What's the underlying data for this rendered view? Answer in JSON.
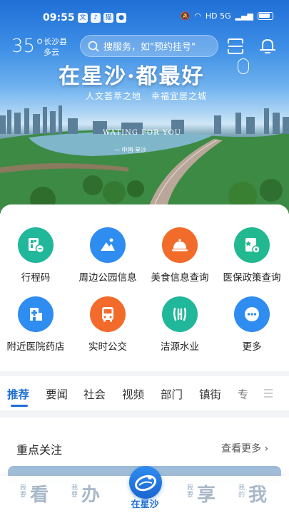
{
  "status_bar": {
    "time": "09:55",
    "apps": [
      "文",
      "♪",
      "猫",
      "●"
    ],
    "network": "HD 5G"
  },
  "header": {
    "weather": {
      "temperature": "35°",
      "county": "长沙县",
      "condition": "多云"
    },
    "search": {
      "placeholder": "搜服务，如\"预约挂号\""
    },
    "icons": [
      "scan-icon",
      "bell-icon"
    ]
  },
  "banner": {
    "slogan": "在星沙·都最好",
    "subtitle_left": "人文荟萃之地",
    "subtitle_right": "幸福宜居之城",
    "english": "WATING FOR YOU",
    "location": "— 中国·星沙"
  },
  "services": [
    {
      "label": "行程码",
      "icon": "itinerary-code-icon",
      "color": "#21b79a"
    },
    {
      "label": "周边公园信息",
      "icon": "park-icon",
      "color": "#2f8cf0"
    },
    {
      "label": "美食信息查询",
      "icon": "food-icon",
      "color": "#f26b2a"
    },
    {
      "label": "医保政策查询",
      "icon": "medical-insurance-icon",
      "color": "#22b890"
    },
    {
      "label": "附近医院药店",
      "icon": "hospital-icon",
      "color": "#2f8cf0"
    },
    {
      "label": "实时公交",
      "icon": "bus-icon",
      "color": "#f26b2a"
    },
    {
      "label": "洁源水业",
      "icon": "water-icon",
      "color": "#21b79a"
    },
    {
      "label": "更多",
      "icon": "more-icon",
      "color": "#2f8cf0"
    }
  ],
  "news_tabs": [
    "推荐",
    "要闻",
    "社会",
    "视频",
    "部门",
    "镇街",
    "专"
  ],
  "focus": {
    "title": "重点关注",
    "more": "查看更多"
  },
  "bottom_nav": {
    "items": [
      {
        "small": "我要",
        "big": "看"
      },
      {
        "small": "我要",
        "big": "办"
      },
      {
        "small": "我要",
        "big": "享"
      },
      {
        "small": "我的",
        "big": "我"
      }
    ],
    "center_label": "在星沙"
  },
  "colors": {
    "primary": "#1f6fd6",
    "teal": "#21b79a",
    "orange": "#f26b2a"
  }
}
